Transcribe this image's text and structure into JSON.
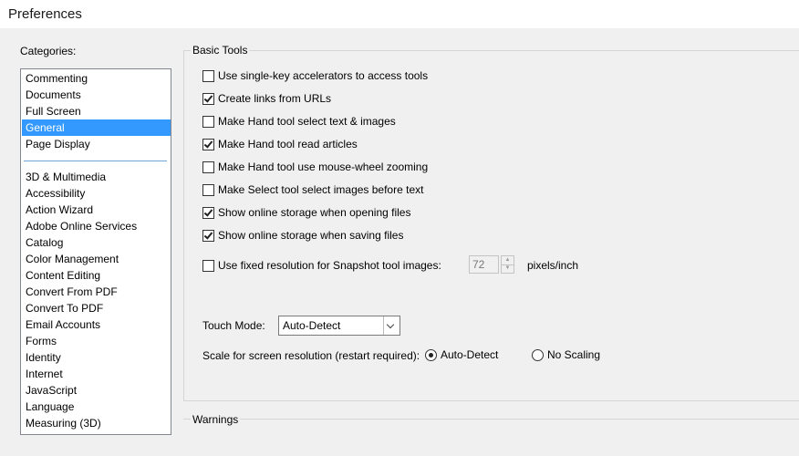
{
  "window": {
    "title": "Preferences"
  },
  "categories": {
    "label": "Categories:",
    "group1": [
      "Commenting",
      "Documents",
      "Full Screen",
      "General",
      "Page Display"
    ],
    "group2": [
      "3D & Multimedia",
      "Accessibility",
      "Action Wizard",
      "Adobe Online Services",
      "Catalog",
      "Color Management",
      "Content Editing",
      "Convert From PDF",
      "Convert To PDF",
      "Email Accounts",
      "Forms",
      "Identity",
      "Internet",
      "JavaScript",
      "Language",
      "Measuring (3D)"
    ],
    "selected": "General"
  },
  "basic_tools": {
    "title": "Basic Tools",
    "options": [
      {
        "label": "Use single-key accelerators to access tools",
        "checked": false
      },
      {
        "label": "Create links from URLs",
        "checked": true
      },
      {
        "label": "Make Hand tool select text & images",
        "checked": false
      },
      {
        "label": "Make Hand tool read articles",
        "checked": true
      },
      {
        "label": "Make Hand tool use mouse-wheel zooming",
        "checked": false
      },
      {
        "label": "Make Select tool select images before text",
        "checked": false
      },
      {
        "label": "Show online storage when opening files",
        "checked": true
      },
      {
        "label": "Show online storage when saving files",
        "checked": true
      }
    ],
    "snapshot": {
      "label": "Use fixed resolution for Snapshot tool images:",
      "checked": false,
      "value": "72",
      "units": "pixels/inch"
    },
    "touch_mode": {
      "label": "Touch Mode:",
      "value": "Auto-Detect"
    },
    "scale": {
      "label": "Scale for screen resolution (restart required):",
      "auto_label": "Auto-Detect",
      "none_label": "No Scaling",
      "selected": "auto"
    }
  },
  "warnings": {
    "title": "Warnings"
  },
  "icons": {
    "checkbox_checked": "checkmark-icon",
    "spin_up": "arrow-up-icon",
    "spin_down": "arrow-down-icon",
    "dropdown": "chevron-down-icon"
  },
  "colors": {
    "selection": "#3399ff",
    "background": "#f0f0f0"
  }
}
